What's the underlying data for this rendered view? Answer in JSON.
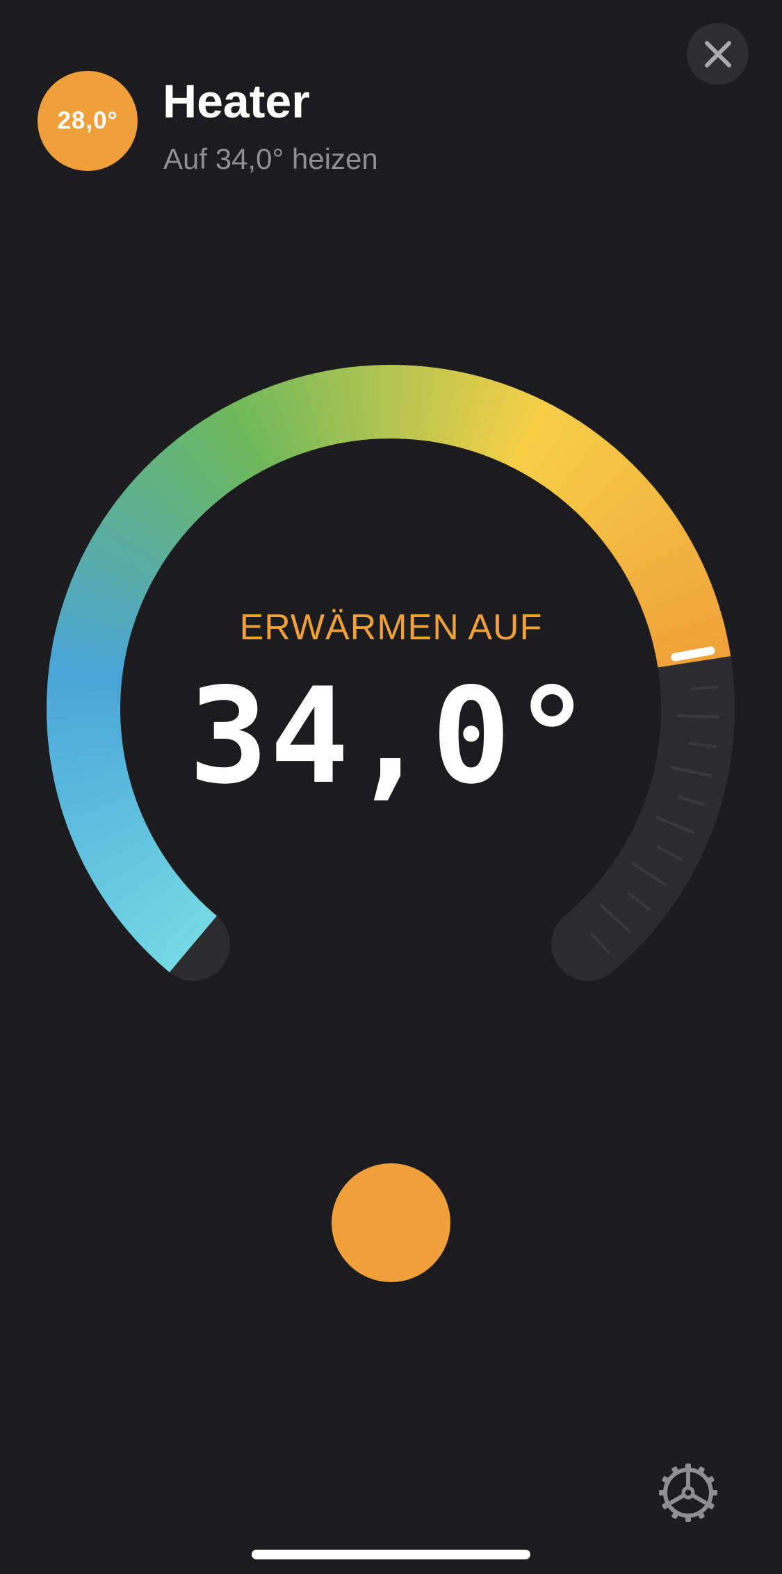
{
  "header": {
    "current_temperature": "28,0°",
    "title": "Heater",
    "subtitle": "Auf 34,0° heizen",
    "close_icon": "close-icon"
  },
  "thermostat": {
    "mode_label": "ERWÄRMEN AUF",
    "target_temperature": "34,0°",
    "dial_fill_fraction": 0.79,
    "gradient_colors": [
      "#74d7e4",
      "#4aa4d8",
      "#6db85c",
      "#f6cf47",
      "#f0a03a"
    ],
    "track_color": "#2c2c2e"
  },
  "controls": {
    "power_icon": "power-button",
    "settings_icon": "gear-icon"
  },
  "colors": {
    "accent": "#f0a03a",
    "background": "#1c1c1e"
  }
}
